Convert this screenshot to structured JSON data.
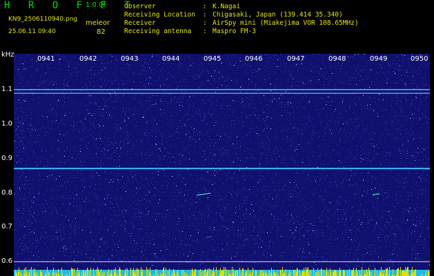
{
  "header": {
    "app_title": "H R O F F T",
    "version": "1.0.0f",
    "filename": "KN9_2506110940.png",
    "station": "meleor",
    "datetime": "25.06.11 09:40",
    "count": "82",
    "info": [
      {
        "key": "Observer",
        "sep": ":",
        "value": "K.Nagai"
      },
      {
        "key": "Receiving Location",
        "sep": ":",
        "value": "Chigasaki, Japan (139.414 35.340)"
      },
      {
        "key": "Receiver",
        "sep": ":",
        "value": "AirSpy mini (Miakejima VOR 108.65MHz)"
      },
      {
        "key": "Receiving antenna",
        "sep": ":",
        "value": "Maspro FM-3"
      }
    ]
  },
  "spectrogram": {
    "y_unit": "kHz",
    "y_ticks": [
      "1.1",
      "1.0",
      "0.9",
      "0.8",
      "0.7",
      "0.6"
    ],
    "x_ticks": [
      "0941",
      "0942",
      "0943",
      "0944",
      "0945",
      "0946",
      "0947",
      "0948",
      "0949",
      "0950"
    ],
    "background_color": "#10106e",
    "signal_color": "#40c0ff",
    "trace_color": "#e0e000"
  },
  "chart_data": {
    "type": "heatmap",
    "xlabel": "",
    "ylabel": "kHz",
    "x_tick_labels": [
      "0941",
      "0942",
      "0943",
      "0944",
      "0945",
      "0946",
      "0947",
      "0948",
      "0949",
      "0950"
    ],
    "y_tick_labels": [
      1.1,
      1.0,
      0.9,
      0.8,
      0.7,
      0.6
    ],
    "ylim": [
      0.58,
      1.2
    ],
    "persistent_lines_khz": [
      1.1,
      1.09,
      0.88,
      0.62
    ]
  }
}
